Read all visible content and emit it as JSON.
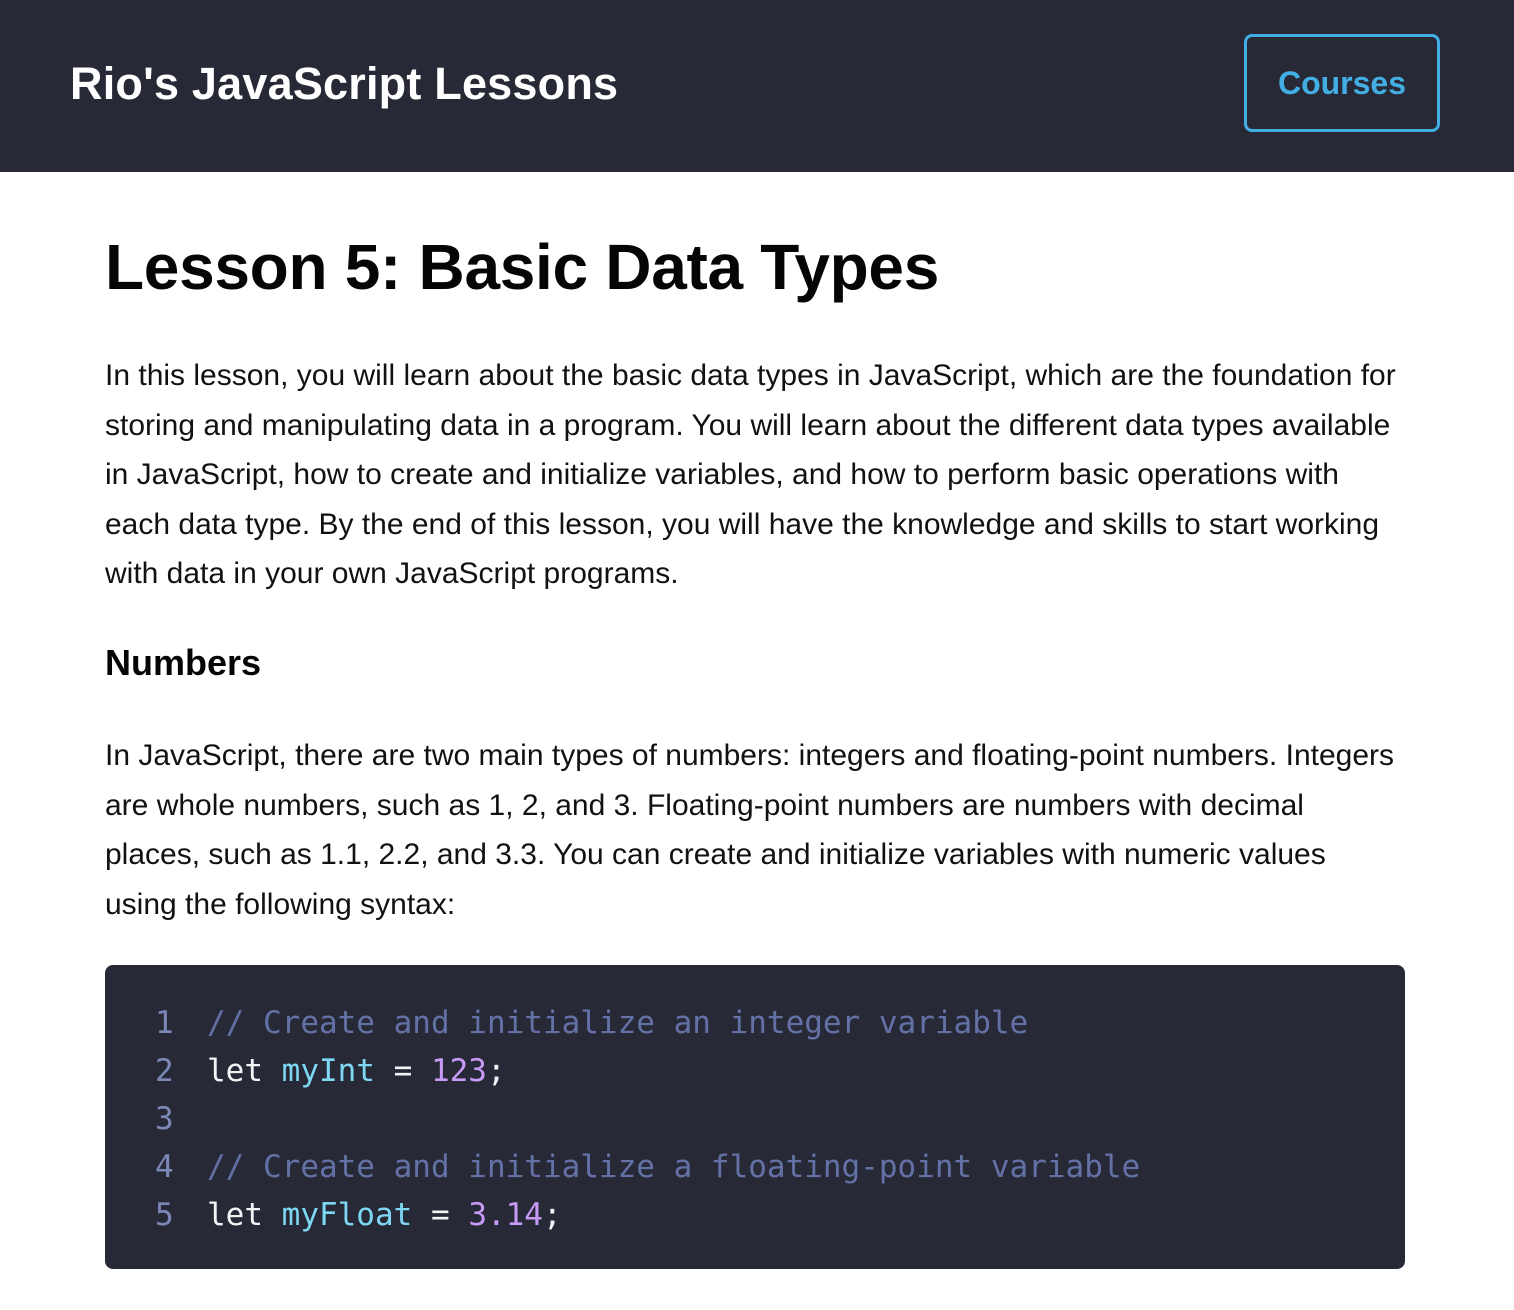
{
  "header": {
    "title": "Rio's JavaScript Lessons",
    "courses_label": "Courses"
  },
  "lesson": {
    "title": "Lesson 5: Basic Data Types",
    "intro": "In this lesson, you will learn about the basic data types in JavaScript, which are the foundation for storing and manipulating data in a program. You will learn about the different data types available in JavaScript, how to create and initialize variables, and how to perform basic operations with each data type. By the end of this lesson, you will have the knowledge and skills to start working with data in your own JavaScript programs."
  },
  "section": {
    "heading": "Numbers",
    "text": "In JavaScript, there are two main types of numbers: integers and floating-point numbers. Integers are whole numbers, such as 1, 2, and 3. Floating-point numbers are numbers with decimal places, such as 1.1, 2.2, and 3.3. You can create and initialize variables with numeric values using the following syntax:"
  },
  "code": {
    "lines": [
      {
        "number": "1",
        "tokens": [
          {
            "type": "comment",
            "text": "// Create and initialize an integer variable"
          }
        ]
      },
      {
        "number": "2",
        "tokens": [
          {
            "type": "keyword",
            "text": "let "
          },
          {
            "type": "var",
            "text": "myInt"
          },
          {
            "type": "op",
            "text": " = "
          },
          {
            "type": "num",
            "text": "123"
          },
          {
            "type": "punct",
            "text": ";"
          }
        ]
      },
      {
        "number": "3",
        "tokens": []
      },
      {
        "number": "4",
        "tokens": [
          {
            "type": "comment",
            "text": "// Create and initialize a floating-point variable"
          }
        ]
      },
      {
        "number": "5",
        "tokens": [
          {
            "type": "keyword",
            "text": "let "
          },
          {
            "type": "var",
            "text": "myFloat"
          },
          {
            "type": "op",
            "text": " = "
          },
          {
            "type": "num",
            "text": "3.14"
          },
          {
            "type": "punct",
            "text": ";"
          }
        ]
      }
    ]
  },
  "colors": {
    "header_bg": "#272a36",
    "accent": "#42aee4",
    "code_bg": "#272a36",
    "comment": "#6471a6",
    "variable": "#7ed7f3",
    "number": "#c79af7"
  }
}
